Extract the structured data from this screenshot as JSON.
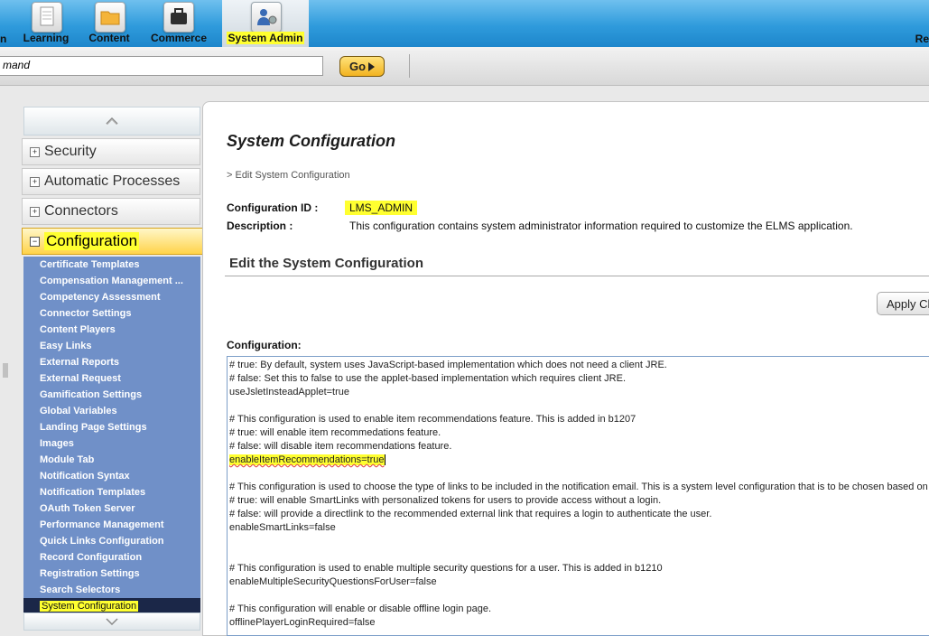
{
  "topnav": {
    "left_fragment": "n",
    "tabs": [
      {
        "label": "Learning",
        "icon": "document-icon"
      },
      {
        "label": "Content",
        "icon": "folder-icon"
      },
      {
        "label": "Commerce",
        "icon": "briefcase-icon"
      },
      {
        "label": "System Admin",
        "icon": "admin-gear-icon",
        "active": true
      }
    ],
    "right_fragment": "Re"
  },
  "command": {
    "input_value": "mand",
    "go_label": "Go"
  },
  "sidebar": {
    "sections": [
      "Security",
      "Automatic Processes",
      "Connectors",
      "Configuration"
    ],
    "active_section": "Configuration",
    "items": [
      "Certificate Templates",
      "Compensation Management ...",
      "Competency Assessment",
      "Connector Settings",
      "Content Players",
      "Easy Links",
      "External Reports",
      "External Request",
      "Gamification Settings",
      "Global Variables",
      "Landing Page Settings",
      "Images",
      "Module Tab",
      "Notification Syntax",
      "Notification Templates",
      "OAuth Token Server",
      "Performance Management",
      "Quick Links Configuration",
      "Record Configuration",
      "Registration Settings",
      "Search Selectors",
      "System Configuration"
    ],
    "selected_item": "System Configuration"
  },
  "main": {
    "title": "System Configuration",
    "breadcrumb": "> Edit System Configuration",
    "config_id_label": "Configuration ID :",
    "config_id_value": "LMS_ADMIN",
    "description_label": "Description :",
    "description_value": "This configuration contains system administrator information required to customize the ELMS application.",
    "section_title": "Edit the System Configuration",
    "apply_label": "Apply Ch",
    "configuration_label": "Configuration:",
    "config_lines": [
      "# true: By default, system uses JavaScript-based implementation which does not need a client JRE.",
      "# false: Set this to false to use the applet-based implementation which requires client JRE.",
      "useJsletInsteadApplet=true",
      "",
      "# This configuration is used to enable item recommendations feature. This is added in b1207",
      "# true: will enable item recommedations feature.",
      "# false: will disable item recommendations feature.",
      "enableItemRecommendations=true",
      "",
      "# This configuration is used to choose the type of links to be included in the notification email. This is a system level configuration that is to be chosen based on",
      "# true: will enable SmartLinks with personalized tokens for users to provide access without a login.",
      "# false: will provide a directlink to the recommended external link that requires a login to authenticate the user.",
      "enableSmartLinks=false",
      "",
      "",
      "# This configuration is used to enable multiple security questions for a user. This is added in b1210",
      "enableMultipleSecurityQuestionsForUser=false",
      "",
      "# This configuration will enable or disable offline login page.",
      "offlinePlayerLoginRequired=false"
    ]
  }
}
